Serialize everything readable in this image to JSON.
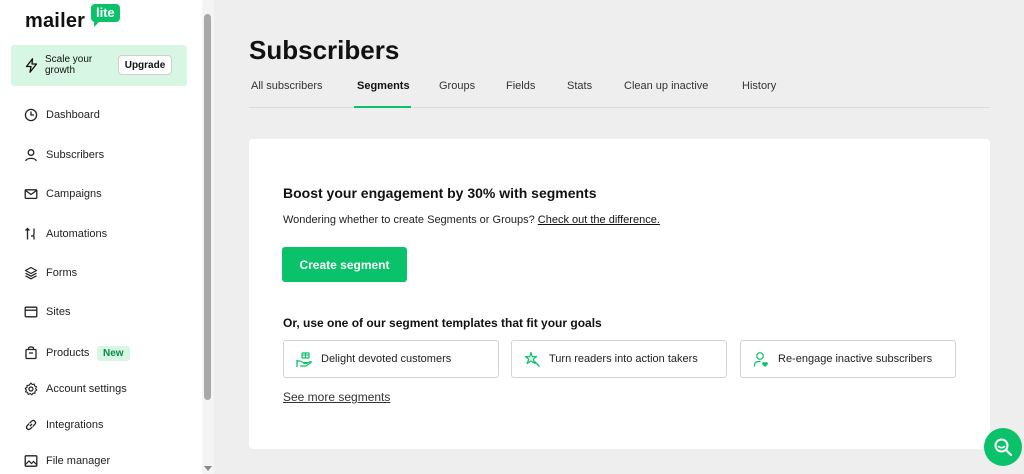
{
  "brand": {
    "name": "mailer",
    "badge": "lite"
  },
  "upgrade": {
    "text": "Scale your growth",
    "button": "Upgrade"
  },
  "sidebar": {
    "items": [
      {
        "label": "Dashboard",
        "icon": "dashboard-icon"
      },
      {
        "label": "Subscribers",
        "icon": "user-icon"
      },
      {
        "label": "Campaigns",
        "icon": "mail-icon"
      },
      {
        "label": "Automations",
        "icon": "automation-icon"
      },
      {
        "label": "Forms",
        "icon": "layers-icon"
      },
      {
        "label": "Sites",
        "icon": "browser-icon"
      },
      {
        "label": "Products",
        "icon": "products-icon",
        "badge": "New"
      },
      {
        "label": "Account settings",
        "icon": "gear-icon"
      },
      {
        "label": "Integrations",
        "icon": "link-icon"
      },
      {
        "label": "File manager",
        "icon": "image-icon"
      }
    ]
  },
  "page": {
    "title": "Subscribers"
  },
  "tabs": [
    {
      "label": "All subscribers"
    },
    {
      "label": "Segments",
      "active": true
    },
    {
      "label": "Groups"
    },
    {
      "label": "Fields"
    },
    {
      "label": "Stats"
    },
    {
      "label": "Clean up inactive"
    },
    {
      "label": "History"
    }
  ],
  "card": {
    "title": "Boost your engagement by 30% with segments",
    "subtitle": "Wondering whether to create Segments or Groups?",
    "subtitle_link": "Check out the difference.",
    "create_button": "Create segment",
    "templates_title": "Or, use one of our segment templates that fit your goals",
    "templates": [
      {
        "label": "Delight devoted customers",
        "icon": "hand-gift-icon"
      },
      {
        "label": "Turn readers into action takers",
        "icon": "sparkle-icon"
      },
      {
        "label": "Re-engage inactive subscribers",
        "icon": "user-heart-icon"
      }
    ],
    "see_more": "See more segments"
  },
  "colors": {
    "accent": "#09c269",
    "accent_light": "#d7f6e4",
    "background": "#eeeeee"
  }
}
